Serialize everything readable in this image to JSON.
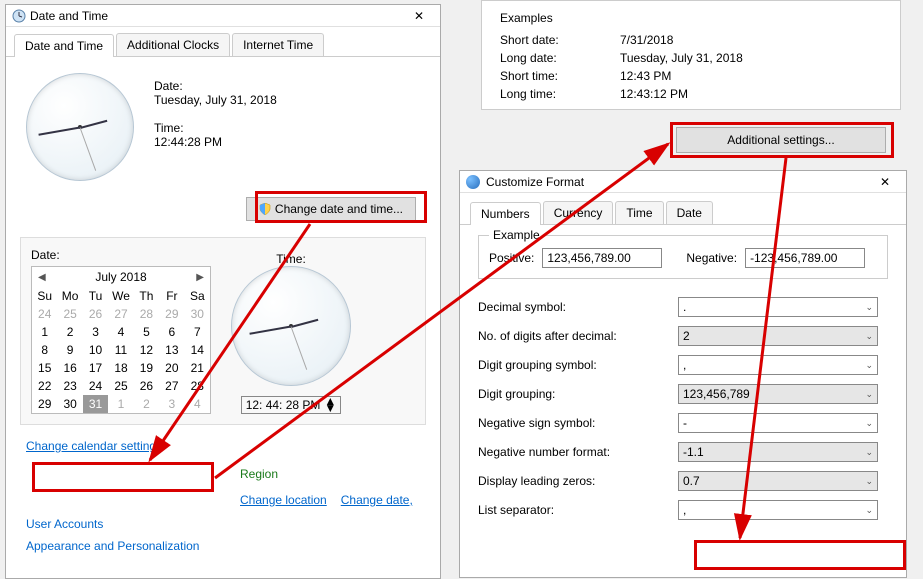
{
  "win1": {
    "title": "Date and Time",
    "tabs": [
      "Date and Time",
      "Additional Clocks",
      "Internet Time"
    ],
    "date_label": "Date:",
    "date_value": "Tuesday, July 31, 2018",
    "time_label": "Time:",
    "time_value": "12:44:28 PM",
    "change_btn": "Change date and time...",
    "panel": {
      "date_label": "Date:",
      "time_label": "Time:",
      "month": "July 2018",
      "dow": [
        "Su",
        "Mo",
        "Tu",
        "We",
        "Th",
        "Fr",
        "Sa"
      ],
      "days_prev": [
        24,
        25,
        26,
        27,
        28,
        29,
        30
      ],
      "days": [
        1,
        2,
        3,
        4,
        5,
        6,
        7,
        8,
        9,
        10,
        11,
        12,
        13,
        14,
        15,
        16,
        17,
        18,
        19,
        20,
        21,
        22,
        23,
        24,
        25,
        26,
        27,
        28,
        29,
        30,
        31
      ],
      "days_next": [
        1,
        2,
        3,
        4
      ],
      "selected": 31,
      "time_input": "12: 44: 28 PM"
    },
    "change_cal_link": "Change calendar settings",
    "categories": {
      "region": "Region",
      "change_location": "Change location",
      "change_date": "Change date,",
      "user_accounts": "User Accounts",
      "appearance": "Appearance and Personalization"
    }
  },
  "examples": {
    "title": "Examples",
    "rows": [
      {
        "l": "Short date:",
        "v": "7/31/2018"
      },
      {
        "l": "Long date:",
        "v": "Tuesday, July 31, 2018"
      },
      {
        "l": "Short time:",
        "v": "12:43 PM"
      },
      {
        "l": "Long time:",
        "v": "12:43:12 PM"
      }
    ],
    "addl_btn": "Additional settings..."
  },
  "win3": {
    "title": "Customize Format",
    "tabs": [
      "Numbers",
      "Currency",
      "Time",
      "Date"
    ],
    "example_label": "Example",
    "positive_label": "Positive:",
    "positive_value": "123,456,789.00",
    "negative_label": "Negative:",
    "negative_value": "-123,456,789.00",
    "rows": [
      {
        "l": "Decimal symbol:",
        "v": ".",
        "white": true
      },
      {
        "l": "No. of digits after decimal:",
        "v": "2"
      },
      {
        "l": "Digit grouping symbol:",
        "v": ",",
        "white": true
      },
      {
        "l": "Digit grouping:",
        "v": "123,456,789"
      },
      {
        "l": "Negative sign symbol:",
        "v": "-",
        "white": true
      },
      {
        "l": "Negative number format:",
        "v": "-1.1"
      },
      {
        "l": "Display leading zeros:",
        "v": "0.7"
      },
      {
        "l": "List separator:",
        "v": ",",
        "white": true
      }
    ]
  }
}
